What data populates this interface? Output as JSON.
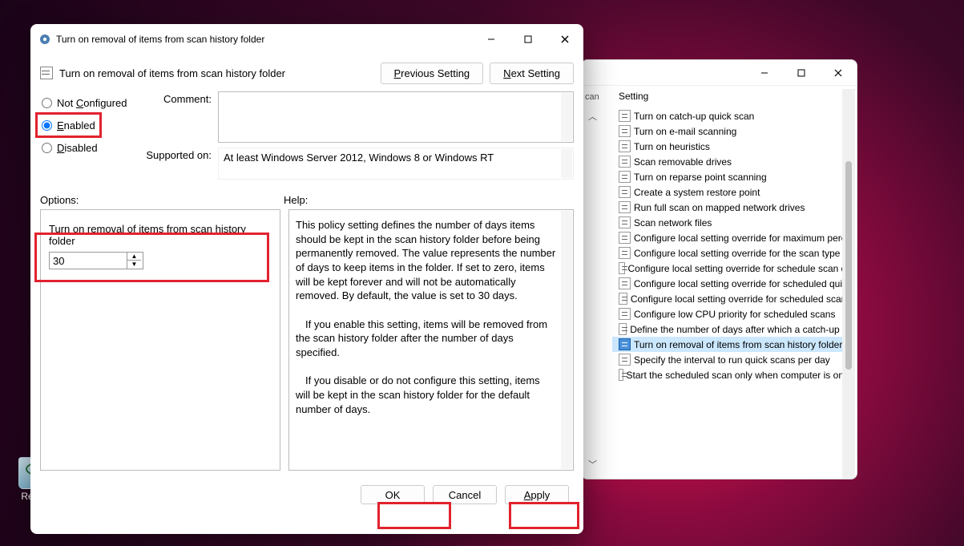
{
  "desktop": {
    "recycle_bin_label": "Recyc"
  },
  "bg_window": {
    "col_left": "can",
    "col_header": "Setting",
    "items": [
      "Turn on catch-up quick scan",
      "Turn on e-mail scanning",
      "Turn on heuristics",
      "Scan removable drives",
      "Turn on reparse point scanning",
      "Create a system restore point",
      "Run full scan on mapped network drives",
      "Scan network files",
      "Configure local setting override for maximum perce",
      "Configure local setting override for the scan type to",
      "Configure local setting override for schedule scan da",
      "Configure local setting override for scheduled quick",
      "Configure local setting override for scheduled scan t",
      "Configure low CPU priority for scheduled scans",
      "Define the number of days after which a catch-up sc",
      "Turn on removal of items from scan history folder",
      "Specify the interval to run quick scans per day",
      "Start the scheduled scan only when computer is on b"
    ],
    "selected_index": 15
  },
  "dialog": {
    "title": "Turn on removal of items from scan history folder",
    "subtitle": "Turn on removal of items from scan history folder",
    "prev_btn": "Previous Setting",
    "next_btn": "Next Setting",
    "radios": {
      "not_configured": "Not Configured",
      "enabled": "Enabled",
      "disabled": "Disabled",
      "selected": "enabled"
    },
    "comment_label": "Comment:",
    "supported_label": "Supported on:",
    "supported_text": "At least Windows Server 2012, Windows 8 or Windows RT",
    "panes": {
      "options_label": "Options:",
      "help_label": "Help:"
    },
    "option": {
      "caption": "Turn on removal of items from scan history folder",
      "value": "30"
    },
    "help_p1": "This policy setting defines the number of days items should be kept in the scan history folder before being permanently removed. The value represents the number of days to keep items in the folder. If set to zero, items will be kept forever and will not be automatically removed. By default, the value is set to 30 days.",
    "help_p2": "If you enable this setting, items will be removed from the scan history folder after the number of days specified.",
    "help_p3": "If you disable or do not configure this setting, items will be kept in the scan history folder for the default number of days.",
    "buttons": {
      "ok": "OK",
      "cancel": "Cancel",
      "apply": "Apply"
    }
  }
}
